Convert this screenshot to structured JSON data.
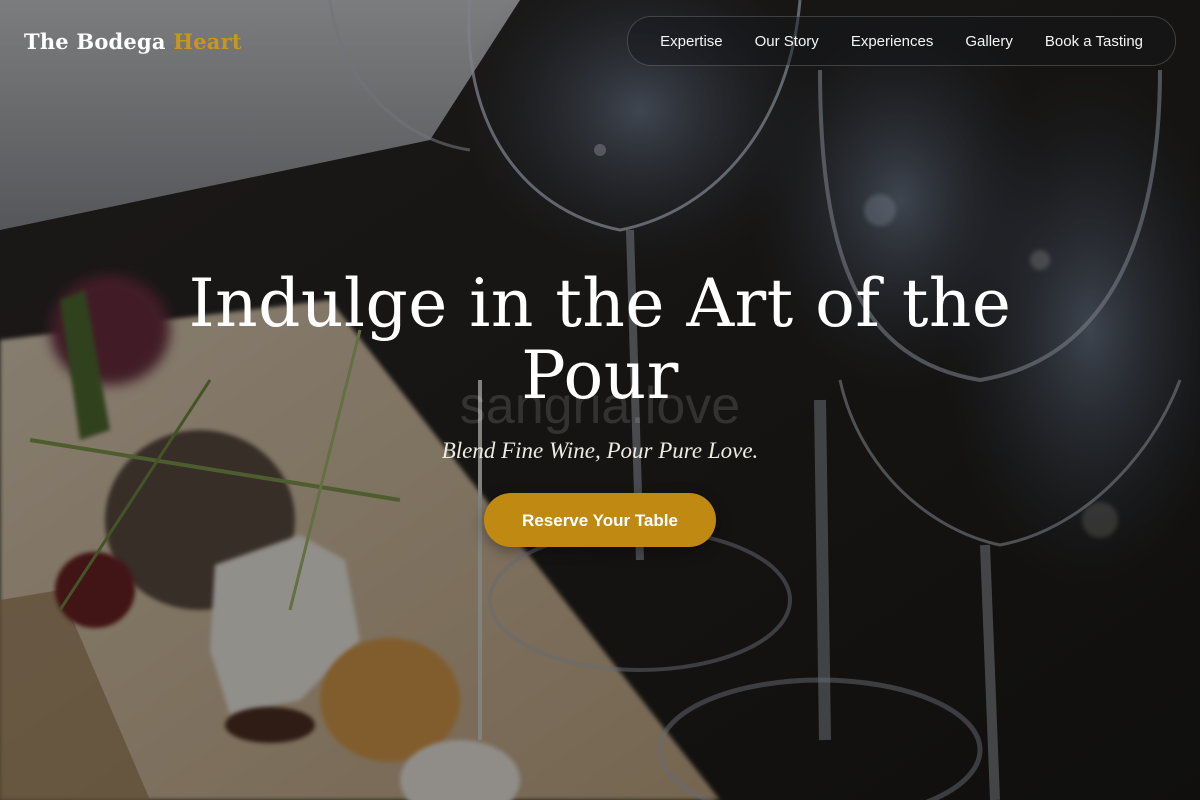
{
  "brand": {
    "name_main": "The Bodega",
    "name_accent": "Heart",
    "accent_color": "#c8961e"
  },
  "nav": {
    "items": [
      {
        "label": "Expertise"
      },
      {
        "label": "Our Story"
      },
      {
        "label": "Experiences"
      },
      {
        "label": "Gallery"
      },
      {
        "label": "Book a Tasting"
      }
    ]
  },
  "hero": {
    "headline": "Indulge in the Art of the Pour",
    "watermark": "sangria.love",
    "tagline": "Blend Fine Wine, Pour Pure Love.",
    "cta_label": "Reserve Your Table",
    "cta_color": "#c08a12",
    "background_image": "blurred photo of wine glasses and a cheese board"
  }
}
